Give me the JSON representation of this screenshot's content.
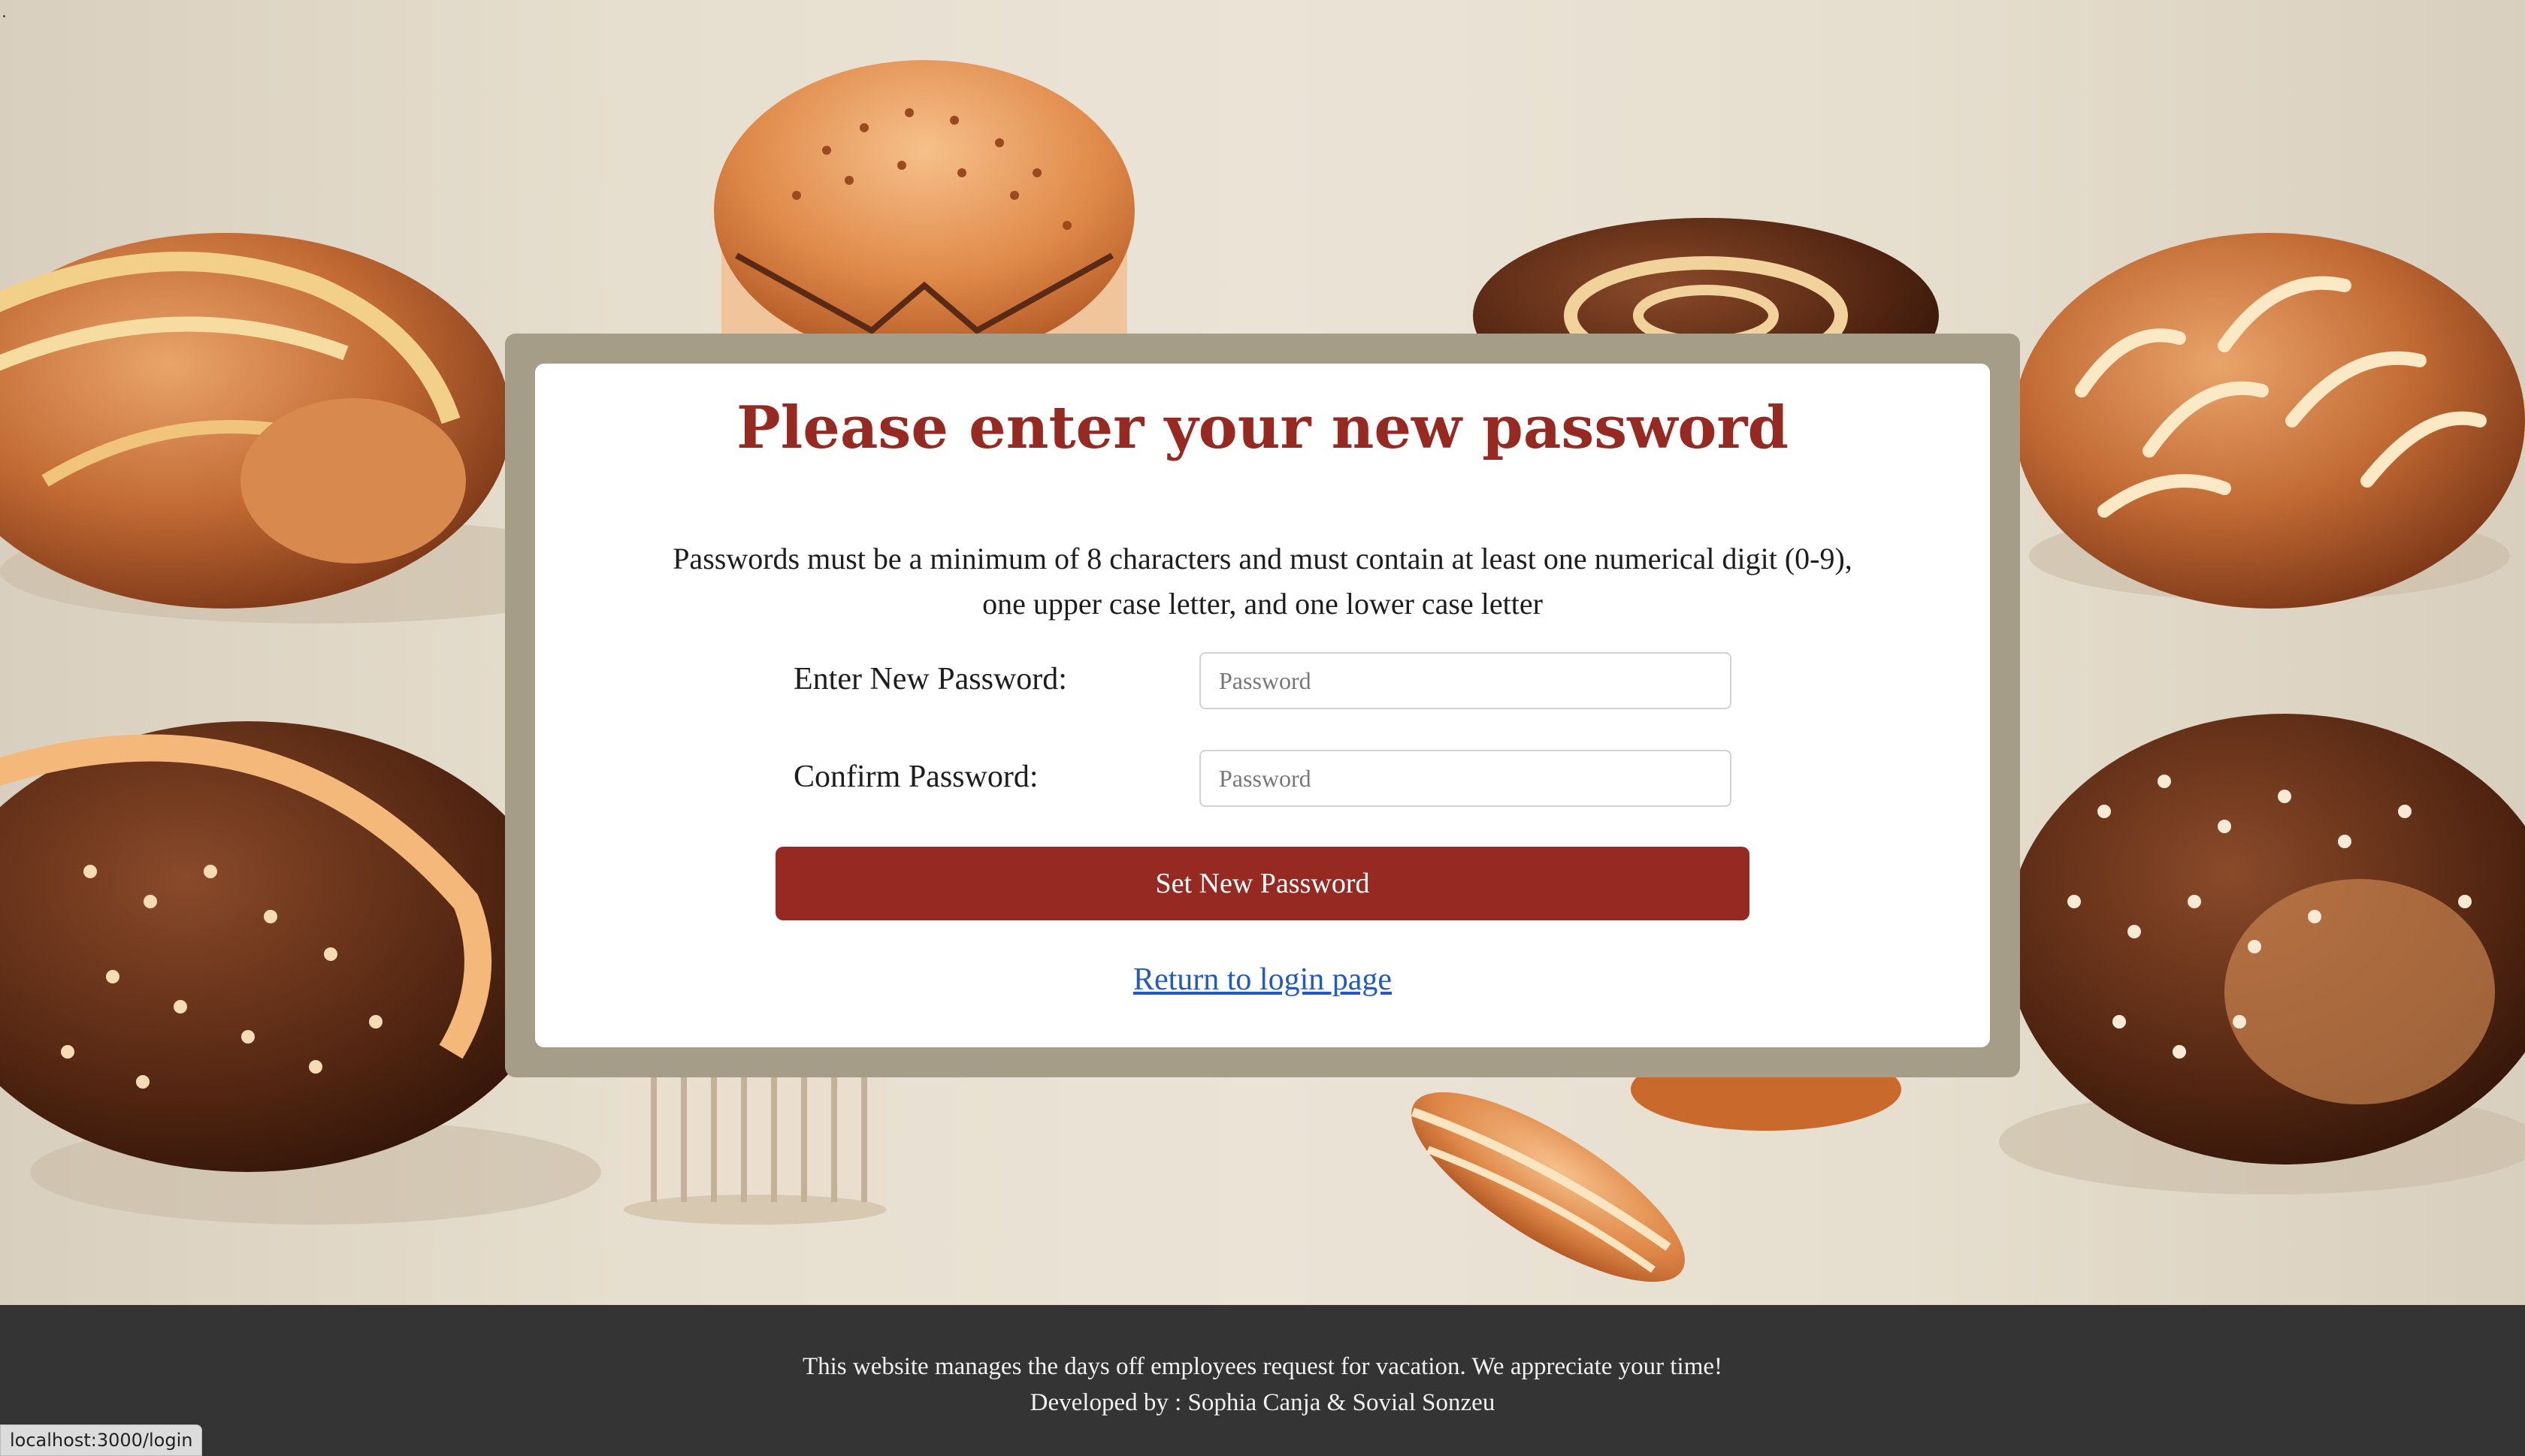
{
  "page": {
    "corner_mark": "."
  },
  "reset": {
    "title": "Please enter your new password",
    "rules": "Passwords must be a minimum of 8 characters and must contain at least one numerical digit (0-9), one upper case letter, and one lower case letter",
    "new_password": {
      "label": "Enter New Password:",
      "value": "",
      "placeholder": "Password"
    },
    "confirm_password": {
      "label": "Confirm Password:",
      "value": "",
      "placeholder": "Password"
    },
    "submit_label": "Set New Password",
    "back_link_label": "Return to login page"
  },
  "footer": {
    "line1": "This website manages the days off employees request for vacation. We appreciate your time!",
    "line2": "Developed by : Sophia Canja & Sovial Sonzeu"
  },
  "status_bar": {
    "url": "localhost:3000/login"
  },
  "colors": {
    "accent": "#962a22",
    "frame": "#a59d88",
    "link": "#2459c2",
    "footer_bg": "#343434",
    "background": "#e0d8ca"
  }
}
